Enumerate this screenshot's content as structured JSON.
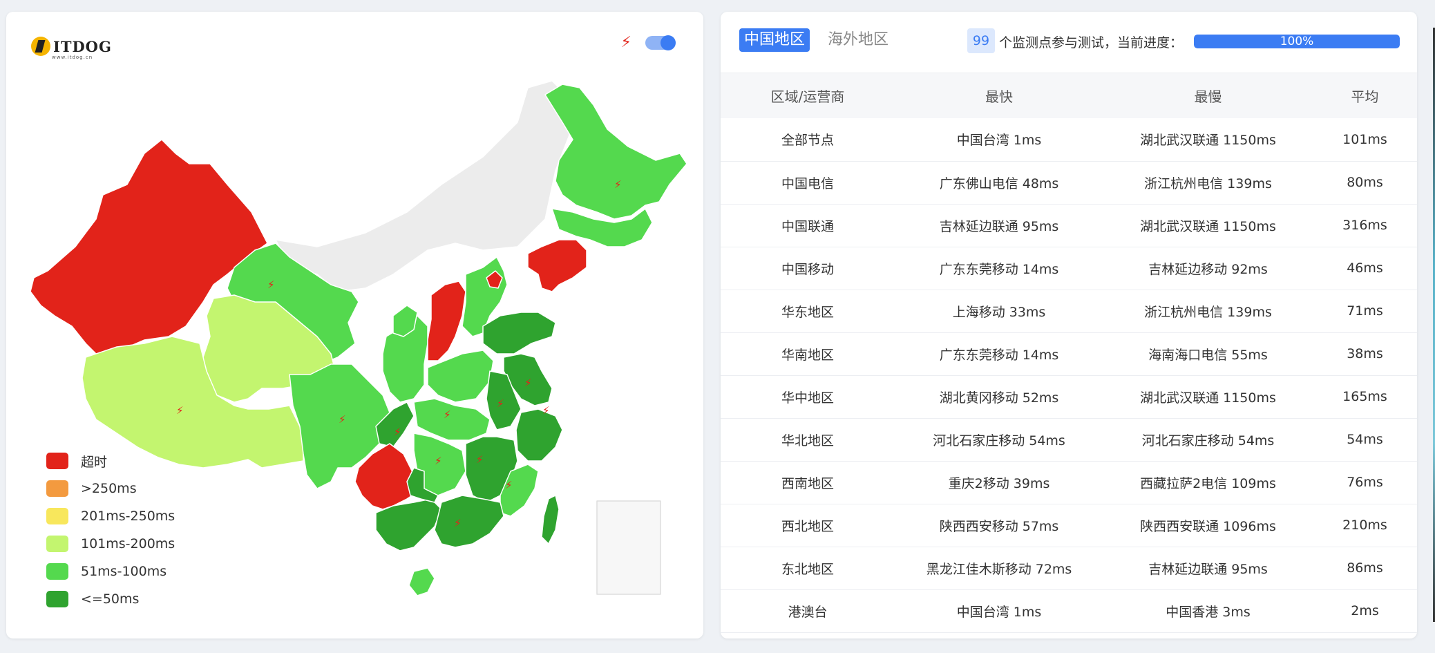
{
  "logo": {
    "text": "ITDOG",
    "subtext": "www.itdog.cn"
  },
  "map_controls": {
    "bolt_icon": "⚡",
    "toggle_on": true
  },
  "legend": [
    {
      "label": "超时",
      "color": "#e2231a"
    },
    {
      "label": ">250ms",
      "color": "#f39a3f"
    },
    {
      "label": "201ms-250ms",
      "color": "#f8e75c"
    },
    {
      "label": "101ms-200ms",
      "color": "#c3f56f"
    },
    {
      "label": "51ms-100ms",
      "color": "#54d94e"
    },
    {
      "label": "<=50ms",
      "color": "#2fa32f"
    }
  ],
  "tabs": {
    "active": "中国地区",
    "inactive": "海外地区"
  },
  "monitor": {
    "count": "99",
    "text": "个监测点参与测试，当前进度：",
    "progress_label": "100%",
    "progress_value": 100
  },
  "table": {
    "headers": [
      "区域/运营商",
      "最快",
      "最慢",
      "平均"
    ],
    "rows": [
      [
        "全部节点",
        "中国台湾 1ms",
        "湖北武汉联通 1150ms",
        "101ms"
      ],
      [
        "中国电信",
        "广东佛山电信 48ms",
        "浙江杭州电信 139ms",
        "80ms"
      ],
      [
        "中国联通",
        "吉林延边联通 95ms",
        "湖北武汉联通 1150ms",
        "316ms"
      ],
      [
        "中国移动",
        "广东东莞移动 14ms",
        "吉林延边移动 92ms",
        "46ms"
      ],
      [
        "华东地区",
        "上海移动 33ms",
        "浙江杭州电信 139ms",
        "71ms"
      ],
      [
        "华南地区",
        "广东东莞移动 14ms",
        "海南海口电信 55ms",
        "38ms"
      ],
      [
        "华中地区",
        "湖北黄冈移动 52ms",
        "湖北武汉联通 1150ms",
        "165ms"
      ],
      [
        "华北地区",
        "河北石家庄移动 54ms",
        "河北石家庄移动 54ms",
        "54ms"
      ],
      [
        "西南地区",
        "重庆2移动 39ms",
        "西藏拉萨2电信 109ms",
        "76ms"
      ],
      [
        "西北地区",
        "陕西西安移动 57ms",
        "陕西西安联通 1096ms",
        "210ms"
      ],
      [
        "东北地区",
        "黑龙江佳木斯移动 72ms",
        "吉林延边联通 95ms",
        "86ms"
      ],
      [
        "港澳台",
        "中国台湾 1ms",
        "中国香港 3ms",
        "2ms"
      ]
    ]
  },
  "colors": {
    "accent": "#3b7cf3",
    "no_data": "#ececec"
  }
}
